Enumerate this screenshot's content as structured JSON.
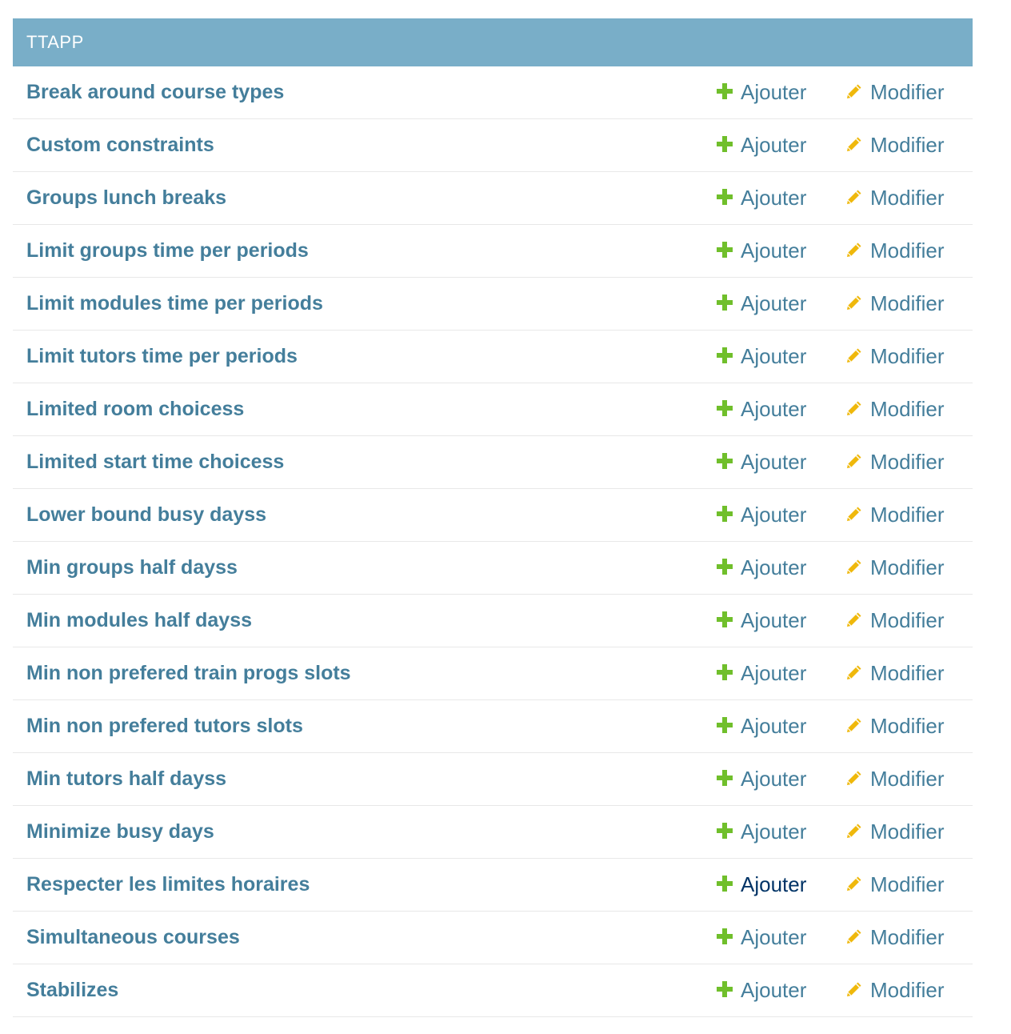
{
  "module": {
    "caption": "TTAPP",
    "rows": [
      {
        "name": "Break around course types",
        "add": "Ajouter",
        "change": "Modifier"
      },
      {
        "name": "Custom constraints",
        "add": "Ajouter",
        "change": "Modifier"
      },
      {
        "name": "Groups lunch breaks",
        "add": "Ajouter",
        "change": "Modifier"
      },
      {
        "name": "Limit groups time per periods",
        "add": "Ajouter",
        "change": "Modifier"
      },
      {
        "name": "Limit modules time per periods",
        "add": "Ajouter",
        "change": "Modifier"
      },
      {
        "name": "Limit tutors time per periods",
        "add": "Ajouter",
        "change": "Modifier"
      },
      {
        "name": "Limited room choicess",
        "add": "Ajouter",
        "change": "Modifier"
      },
      {
        "name": "Limited start time choicess",
        "add": "Ajouter",
        "change": "Modifier"
      },
      {
        "name": "Lower bound busy dayss",
        "add": "Ajouter",
        "change": "Modifier"
      },
      {
        "name": "Min groups half dayss",
        "add": "Ajouter",
        "change": "Modifier"
      },
      {
        "name": "Min modules half dayss",
        "add": "Ajouter",
        "change": "Modifier"
      },
      {
        "name": "Min non prefered train progs slots",
        "add": "Ajouter",
        "change": "Modifier"
      },
      {
        "name": "Min non prefered tutors slots",
        "add": "Ajouter",
        "change": "Modifier"
      },
      {
        "name": "Min tutors half dayss",
        "add": "Ajouter",
        "change": "Modifier"
      },
      {
        "name": "Minimize busy days",
        "add": "Ajouter",
        "change": "Modifier"
      },
      {
        "name": "Respecter les limites horaires",
        "add": "Ajouter",
        "change": "Modifier"
      },
      {
        "name": "Simultaneous courses",
        "add": "Ajouter",
        "change": "Modifier"
      },
      {
        "name": "Stabilizes",
        "add": "Ajouter",
        "change": "Modifier"
      }
    ]
  },
  "icons": {
    "add": "plus-icon",
    "change": "pencil-icon"
  },
  "colors": {
    "caption_bg": "#79aec8",
    "link": "#447e9b",
    "link_hover": "#003366",
    "add_icon": "#70bf2b",
    "change_icon": "#efb80b"
  }
}
